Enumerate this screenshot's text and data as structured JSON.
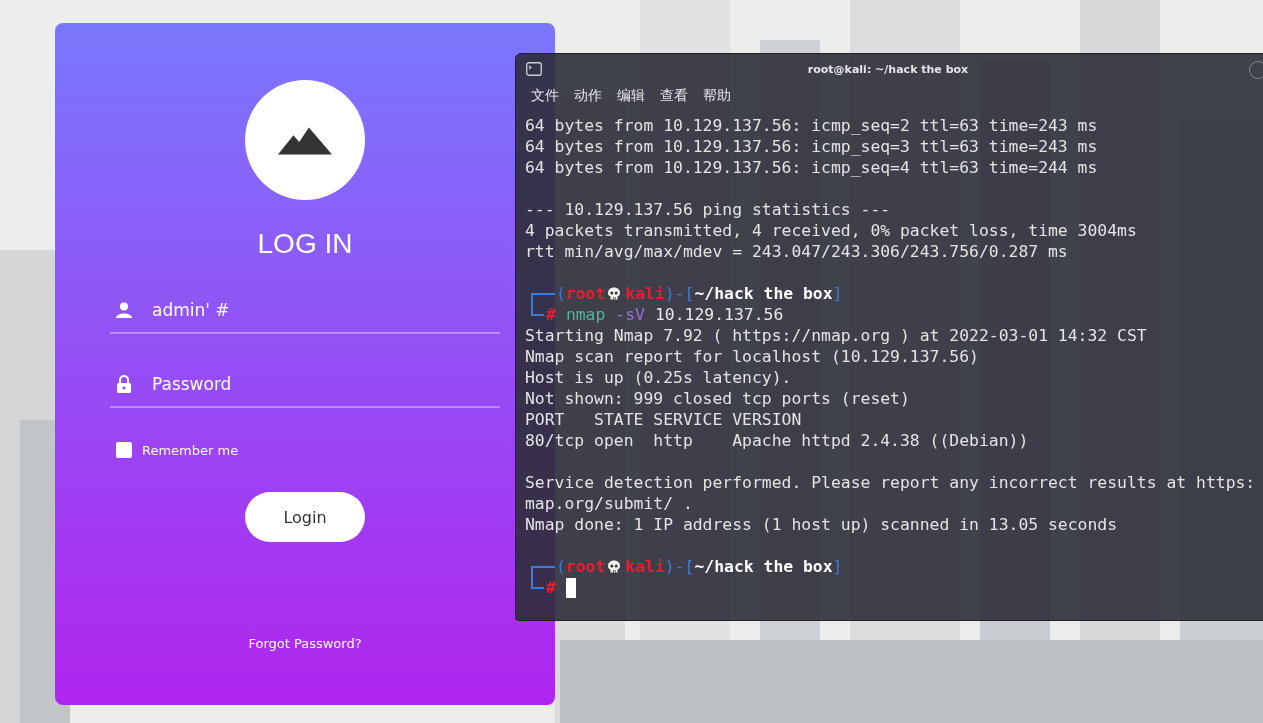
{
  "login": {
    "title": "LOG IN",
    "username": {
      "value": "admin' #"
    },
    "password": {
      "placeholder": "Password"
    },
    "remember": {
      "label": "Remember me",
      "checked": false
    },
    "button": "Login",
    "forgot": "Forgot Password?"
  },
  "terminal": {
    "title": "root@kali: ~/hack the box",
    "menu": [
      "文件",
      "动作",
      "编辑",
      "查看",
      "帮助"
    ],
    "lines": [
      {
        "kind": "text",
        "text": "64 bytes from 10.129.137.56: icmp_seq=2 ttl=63 time=243 ms"
      },
      {
        "kind": "text",
        "text": "64 bytes from 10.129.137.56: icmp_seq=3 ttl=63 time=243 ms"
      },
      {
        "kind": "text",
        "text": "64 bytes from 10.129.137.56: icmp_seq=4 ttl=63 time=244 ms"
      },
      {
        "kind": "blank"
      },
      {
        "kind": "text",
        "text": "--- 10.129.137.56 ping statistics ---"
      },
      {
        "kind": "text",
        "text": "4 packets transmitted, 4 received, 0% packet loss, time 3004ms"
      },
      {
        "kind": "text",
        "text": "rtt min/avg/max/mdev = 243.047/243.306/243.756/0.287 ms"
      },
      {
        "kind": "blank"
      },
      {
        "kind": "prompt",
        "parts": [
          {
            "kind": "text",
            "text": "(",
            "color": "#3d7bd9",
            "bold": false
          },
          {
            "kind": "text",
            "text": "root",
            "color": "#e3202f",
            "bold": true
          },
          {
            "kind": "skull"
          },
          {
            "kind": "text",
            "text": "kali",
            "color": "#e3202f",
            "bold": true
          },
          {
            "kind": "text",
            "text": ")-[",
            "color": "#3d7bd9",
            "bold": false
          },
          {
            "kind": "text",
            "text": "~/hack the box",
            "color": "#ffffff",
            "bold": true
          },
          {
            "kind": "text",
            "text": "]",
            "color": "#3d7bd9",
            "bold": false
          }
        ]
      },
      {
        "kind": "command",
        "cursor": false,
        "parts": [
          {
            "text": "#",
            "color": "#e3202f"
          },
          {
            "text": "nmap",
            "color": "#4fb89a"
          },
          {
            "text": "-sV",
            "color": "#9b6fe0"
          },
          {
            "text": "10.129.137.56",
            "color": "#e8e8e8"
          }
        ]
      },
      {
        "kind": "text",
        "text": "Starting Nmap 7.92 ( https://nmap.org ) at 2022-03-01 14:32 CST"
      },
      {
        "kind": "text",
        "text": "Nmap scan report for localhost (10.129.137.56)"
      },
      {
        "kind": "text",
        "text": "Host is up (0.25s latency)."
      },
      {
        "kind": "text",
        "text": "Not shown: 999 closed tcp ports (reset)"
      },
      {
        "kind": "text",
        "text": "PORT   STATE SERVICE VERSION"
      },
      {
        "kind": "text",
        "text": "80/tcp open  http    Apache httpd 2.4.38 ((Debian))"
      },
      {
        "kind": "blank"
      },
      {
        "kind": "text",
        "text": "Service detection performed. Please report any incorrect results at https:"
      },
      {
        "kind": "text",
        "text": "map.org/submit/ ."
      },
      {
        "kind": "text",
        "text": "Nmap done: 1 IP address (1 host up) scanned in 13.05 seconds"
      },
      {
        "kind": "blank"
      },
      {
        "kind": "prompt",
        "parts": [
          {
            "kind": "text",
            "text": "(",
            "color": "#3d7bd9",
            "bold": false
          },
          {
            "kind": "text",
            "text": "root",
            "color": "#e3202f",
            "bold": true
          },
          {
            "kind": "skull"
          },
          {
            "kind": "text",
            "text": "kali",
            "color": "#e3202f",
            "bold": true
          },
          {
            "kind": "text",
            "text": ")-[",
            "color": "#3d7bd9",
            "bold": false
          },
          {
            "kind": "text",
            "text": "~/hack the box",
            "color": "#ffffff",
            "bold": true
          },
          {
            "kind": "text",
            "text": "]",
            "color": "#3d7bd9",
            "bold": false
          }
        ]
      },
      {
        "kind": "command",
        "cursor": true,
        "parts": [
          {
            "text": "#",
            "color": "#e3202f"
          }
        ]
      }
    ]
  }
}
